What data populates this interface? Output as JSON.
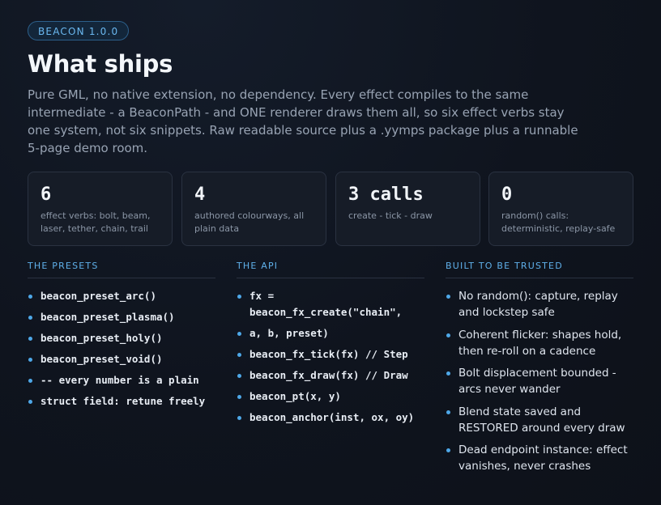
{
  "badge": "BEACON 1.0.0",
  "title": "What ships",
  "lead": "Pure GML, no native extension, no dependency. Every effect compiles to the same intermediate - a BeaconPath - and ONE renderer draws them all, so six effect verbs stay one system, not six snippets. Raw readable source plus a .yymps package plus a runnable 5-page demo room.",
  "stats": [
    {
      "value": "6",
      "label": "effect verbs: bolt, beam, laser, tether, chain, trail"
    },
    {
      "value": "4",
      "label": "authored colourways, all plain data"
    },
    {
      "value": "3 calls",
      "label": "create - tick - draw"
    },
    {
      "value": "0",
      "label": "random() calls: deterministic, replay-safe"
    }
  ],
  "presets": {
    "heading": "THE PRESETS",
    "items": [
      "beacon_preset_arc()",
      "beacon_preset_plasma()",
      "beacon_preset_holy()",
      "beacon_preset_void()",
      "-- every number is a plain",
      "struct field: retune freely"
    ]
  },
  "api": {
    "heading": "THE API",
    "items": [
      "fx = beacon_fx_create(\"chain\",",
      "a, b, preset)",
      "beacon_fx_tick(fx) // Step",
      "beacon_fx_draw(fx) // Draw",
      "beacon_pt(x, y)",
      "beacon_anchor(inst, ox, oy)"
    ]
  },
  "trusted": {
    "heading": "BUILT TO BE TRUSTED",
    "items": [
      "No random(): capture, replay and lockstep safe",
      "Coherent flicker: shapes hold, then re-roll on a cadence",
      "Bolt displacement bounded - arcs never wander",
      "Blend state saved and RESTORED around every draw",
      "Dead endpoint instance: effect vanishes, never crashes"
    ]
  }
}
